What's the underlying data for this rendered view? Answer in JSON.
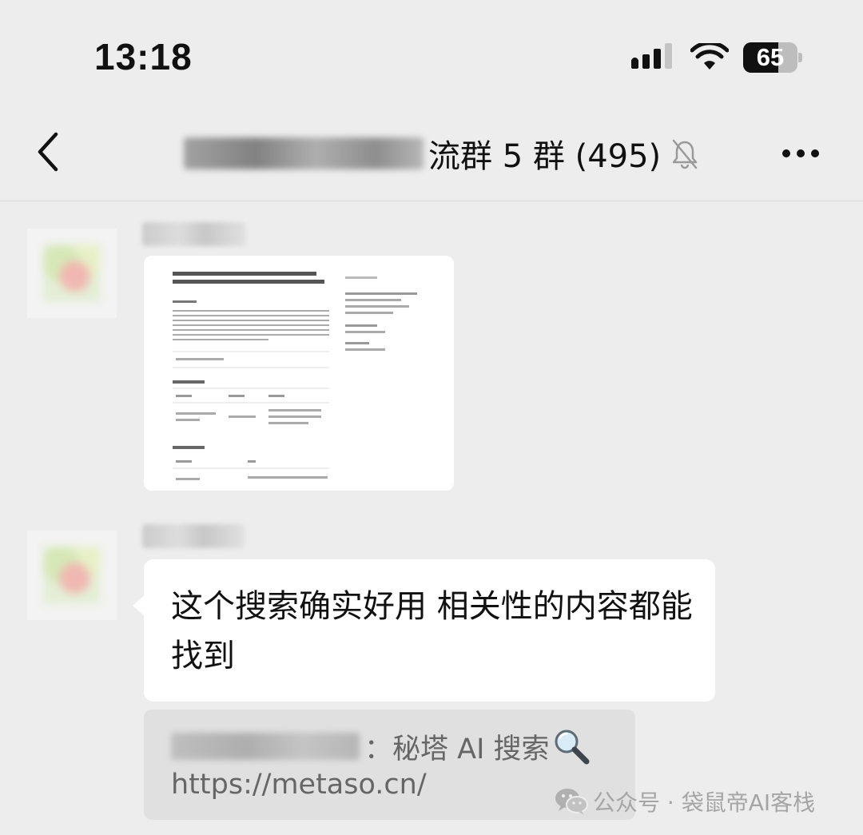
{
  "status_bar": {
    "time": "13:18",
    "battery_level": "65",
    "battery_fraction": 0.65,
    "icons": [
      "signal-icon",
      "wifi-icon",
      "battery-icon"
    ]
  },
  "nav": {
    "title_visible": "流群 5 群 (495)",
    "back_icon": "chevron-left-icon",
    "mute_icon": "bell-slash-icon",
    "more_icon": "ellipsis-icon"
  },
  "messages": [
    {
      "type": "image",
      "content": "screenshot-thumbnail"
    },
    {
      "type": "text",
      "text": "这个搜索确实好用  相关性的内容都能找到",
      "quote": {
        "text": "：秘塔 AI 搜索",
        "icon": "magnifier-icon",
        "url": "https://metaso.cn/"
      }
    }
  ],
  "watermark": {
    "icon": "wechat-icon",
    "text": "公众号 · 袋鼠帝AI客栈"
  },
  "colors": {
    "background": "#ededed",
    "bubble": "#ffffff",
    "quote_bubble": "#e0e0e0",
    "quote_text": "#666666",
    "watermark": "#a5a5a5"
  }
}
